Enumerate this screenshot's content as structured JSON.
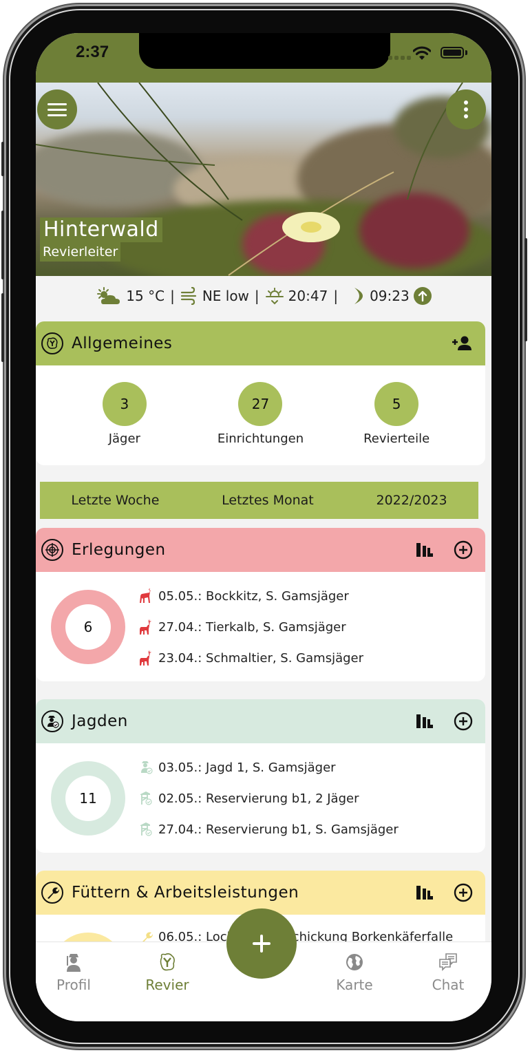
{
  "status_bar": {
    "time": "2:37"
  },
  "hero": {
    "title": "Hinterwald",
    "subtitle": "Revierleiter"
  },
  "weather": {
    "temperature": "15 °C",
    "wind": "NE low",
    "sunset": "20:47",
    "moon_time": "09:23",
    "separator": "|"
  },
  "general": {
    "title": "Allgemeines",
    "stats": [
      {
        "value": "3",
        "label": "Jäger"
      },
      {
        "value": "27",
        "label": "Einrichtungen"
      },
      {
        "value": "5",
        "label": "Revierteile"
      }
    ]
  },
  "periods": [
    "Letzte Woche",
    "Letztes Monat",
    "2022/2023"
  ],
  "sections": [
    {
      "title": "Erlegungen",
      "count": "6",
      "color": "#f3a7aa",
      "entries": [
        "05.05.: Bockkitz, S. Gamsjäger",
        "27.04.: Tierkalb, S. Gamsjäger",
        "23.04.: Schmaltier, S. Gamsjäger"
      ]
    },
    {
      "title": "Jagden",
      "count": "11",
      "color": "#d7eadf",
      "entries": [
        "03.05.: Jagd 1, S. Gamsjäger",
        "02.05.: Reservierung b1, 2 Jäger",
        "27.04.: Reservierung b1, S. Gamsjäger"
      ]
    },
    {
      "title": "Füttern & Arbeitsleistungen",
      "color": "#fbe9a0",
      "entries": [
        "06.05.: Lockmittelbeschickung Borkenkäferfalle"
      ]
    }
  ],
  "tabbar": {
    "items": [
      {
        "label": "Profil"
      },
      {
        "label": "Revier"
      },
      {
        "label": "Karte"
      },
      {
        "label": "Chat"
      }
    ],
    "active": "Revier"
  },
  "colors": {
    "primary": "#6e7f37",
    "accent_light": "#a9bf5b",
    "harvest": "#f3a7aa",
    "hunts": "#d7eadf",
    "feeding": "#fbe9a0",
    "deer_icon": "#e03a3e"
  }
}
